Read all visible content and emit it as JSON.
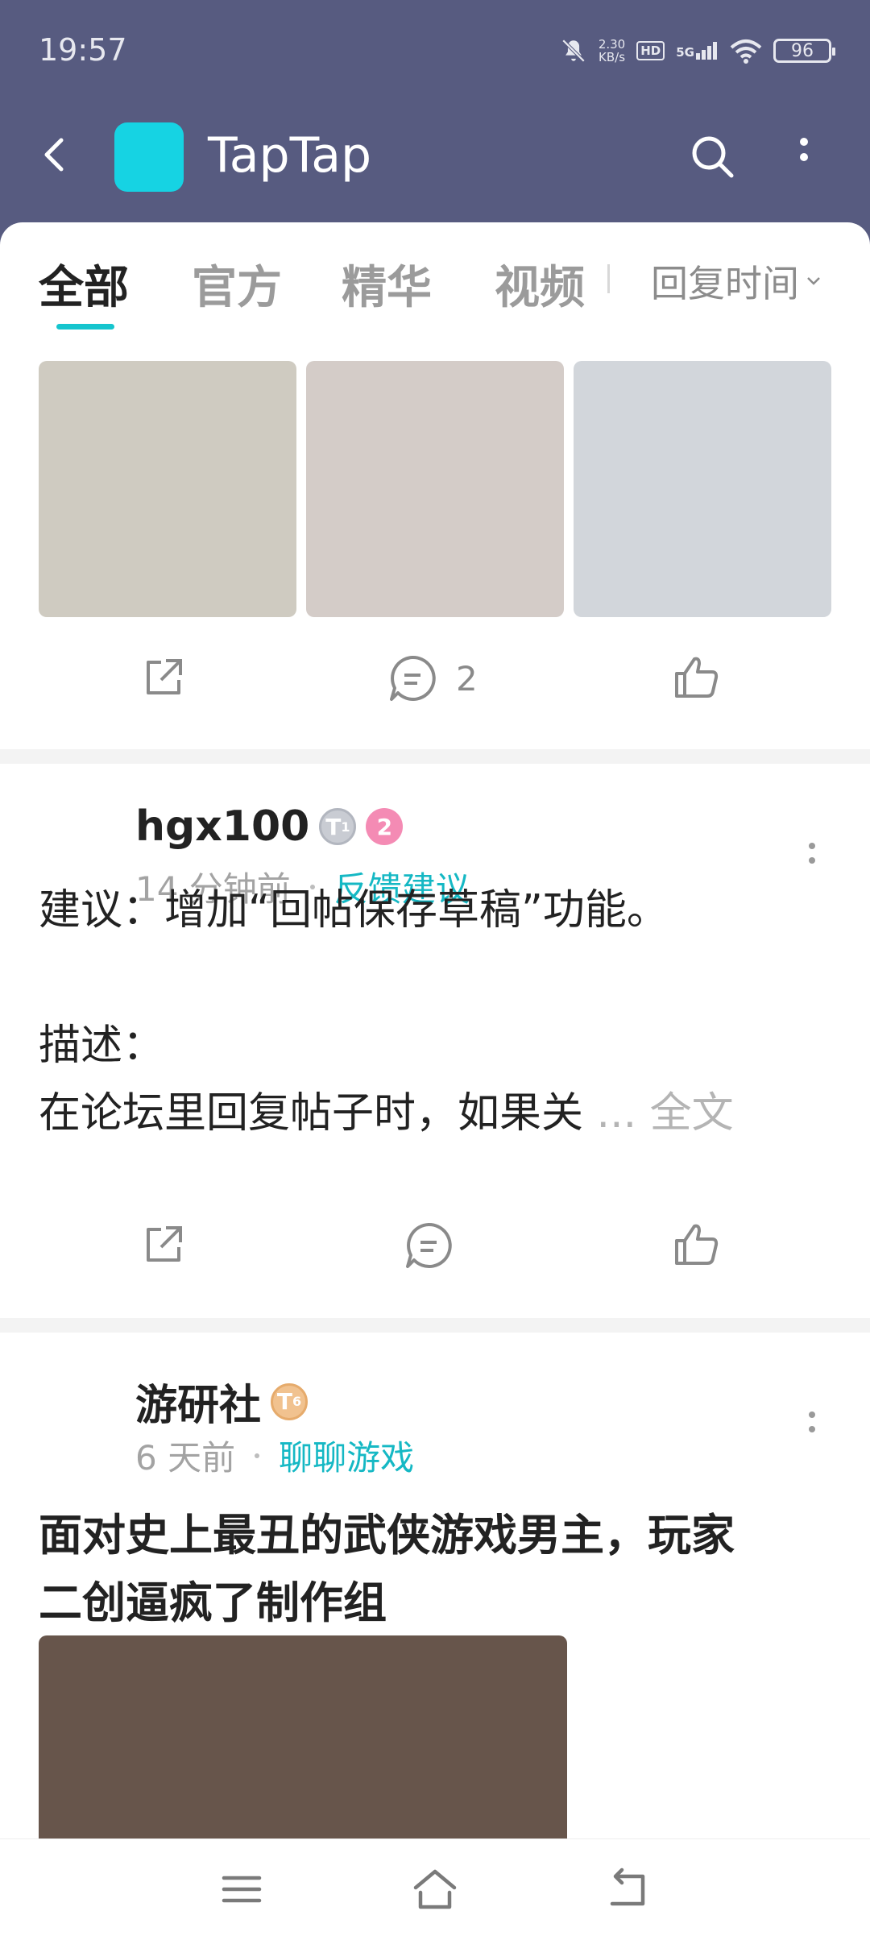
{
  "status": {
    "time": "19:57",
    "net_speed_value": "2.30",
    "net_speed_unit": "KB/s",
    "hd": "HD",
    "signal": "5G",
    "battery": "96"
  },
  "app": {
    "title": "TapTap",
    "logo_color": "#16d3e3",
    "header_color": "#575b80"
  },
  "tabs": [
    {
      "label": "全部",
      "active": true
    },
    {
      "label": "官方",
      "active": false
    },
    {
      "label": "精华",
      "active": false
    },
    {
      "label": "视频",
      "active": false
    }
  ],
  "sort": {
    "label": "回复时间"
  },
  "first_post": {
    "image_colors": [
      "#cfcbc1",
      "#d4ccc8",
      "#d2d6db"
    ],
    "comment_count": "2"
  },
  "posts": [
    {
      "username": "hgx100",
      "level_badge": "T",
      "level_sub": "1",
      "rank_badge": "2",
      "time": "14 分钟前",
      "category": "反馈建议",
      "lines": [
        "建议：增加“回帖保存草稿”功能。",
        "",
        "描述：",
        "在论坛里回复帖子时，如果关"
      ],
      "ellipsis": "...",
      "full_text": "全文"
    },
    {
      "username": "游研社",
      "level_badge": "T",
      "level_sub": "6",
      "time": "6 天前",
      "category": "聊聊游戏",
      "headline_lines": [
        "面对史上最丑的武侠游戏男主，玩家",
        "二创逼疯了制作组"
      ],
      "cover_color": "#67554b"
    }
  ],
  "accent": "#15c5ce"
}
